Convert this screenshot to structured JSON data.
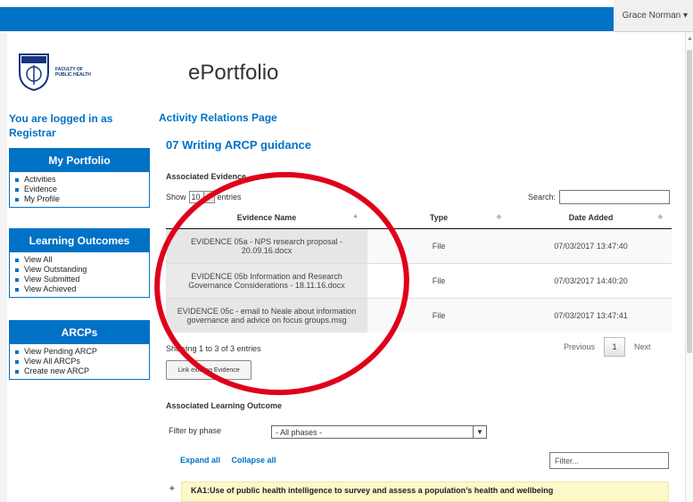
{
  "header": {
    "user_name": "Grace Norman ▾"
  },
  "logo": {
    "line1": "FACULTY OF",
    "line2": "PUBLIC HEALTH"
  },
  "app_title": "ePortfolio",
  "login_note": "You are logged in as Registrar",
  "nav": {
    "portfolio": {
      "title": "My Portfolio",
      "items": [
        "Activities",
        "Evidence",
        "My Profile"
      ]
    },
    "outcomes": {
      "title": "Learning Outcomes",
      "items": [
        "View All",
        "View Outstanding",
        "View Submitted",
        "View Achieved"
      ]
    },
    "arcps": {
      "title": "ARCPs",
      "items": [
        "View Pending ARCP",
        "View All ARCPs",
        "Create new ARCP"
      ]
    }
  },
  "page": {
    "heading": "Activity Relations Page",
    "subheading": "07 Writing ARCP guidance",
    "evidence_label": "Associated Evidence"
  },
  "table_controls": {
    "show_label": "Show",
    "page_size": "10",
    "entries_label": "entries",
    "search_label": "Search:"
  },
  "table": {
    "headers": [
      "Evidence Name",
      "Type",
      "Date Added"
    ],
    "rows": [
      [
        "EVIDENCE 05a - NPS research proposal - 20.09.16.docx",
        "File",
        "07/03/2017 13:47:40"
      ],
      [
        "EVIDENCE 05b Information and Research Governance Considerations - 18.11.16.docx",
        "File",
        "07/03/2017 14:40:20"
      ],
      [
        "EVIDENCE 05c - email to Neale about information governance and advice on focus groups.msg",
        "File",
        "07/03/2017 13:47:41"
      ]
    ]
  },
  "table_footer": {
    "info": "Showing 1 to 3 of 3 entries",
    "previous": "Previous",
    "page": "1",
    "next": "Next",
    "link_button": "Link existing Evidence"
  },
  "outcome": {
    "label": "Associated Learning Outcome",
    "filter_label": "Filter by phase",
    "phase_value": "- All phases -",
    "expand_all": "Expand all",
    "collapse_all": "Collapse all",
    "filter_placeholder": "Filter...",
    "ka_plus": "+",
    "ka_text": "KA1:Use of public health intelligence to survey and assess a population’s health and wellbeing"
  },
  "colors": {
    "accent": "#0072c6",
    "annotation": "#e0001a",
    "highlight_row": "#fcf8c9"
  }
}
